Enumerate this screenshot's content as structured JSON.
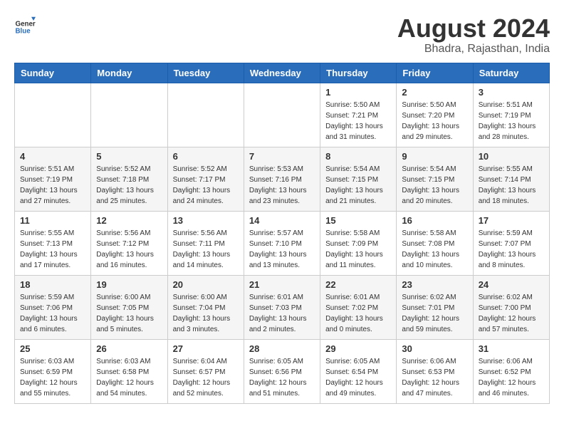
{
  "logo": {
    "general": "General",
    "blue": "Blue"
  },
  "title": {
    "month_year": "August 2024",
    "location": "Bhadra, Rajasthan, India"
  },
  "headers": [
    "Sunday",
    "Monday",
    "Tuesday",
    "Wednesday",
    "Thursday",
    "Friday",
    "Saturday"
  ],
  "weeks": [
    [
      {
        "day": "",
        "sunrise": "",
        "sunset": "",
        "daylight": ""
      },
      {
        "day": "",
        "sunrise": "",
        "sunset": "",
        "daylight": ""
      },
      {
        "day": "",
        "sunrise": "",
        "sunset": "",
        "daylight": ""
      },
      {
        "day": "",
        "sunrise": "",
        "sunset": "",
        "daylight": ""
      },
      {
        "day": "1",
        "sunrise": "Sunrise: 5:50 AM",
        "sunset": "Sunset: 7:21 PM",
        "daylight": "Daylight: 13 hours and 31 minutes."
      },
      {
        "day": "2",
        "sunrise": "Sunrise: 5:50 AM",
        "sunset": "Sunset: 7:20 PM",
        "daylight": "Daylight: 13 hours and 29 minutes."
      },
      {
        "day": "3",
        "sunrise": "Sunrise: 5:51 AM",
        "sunset": "Sunset: 7:19 PM",
        "daylight": "Daylight: 13 hours and 28 minutes."
      }
    ],
    [
      {
        "day": "4",
        "sunrise": "Sunrise: 5:51 AM",
        "sunset": "Sunset: 7:19 PM",
        "daylight": "Daylight: 13 hours and 27 minutes."
      },
      {
        "day": "5",
        "sunrise": "Sunrise: 5:52 AM",
        "sunset": "Sunset: 7:18 PM",
        "daylight": "Daylight: 13 hours and 25 minutes."
      },
      {
        "day": "6",
        "sunrise": "Sunrise: 5:52 AM",
        "sunset": "Sunset: 7:17 PM",
        "daylight": "Daylight: 13 hours and 24 minutes."
      },
      {
        "day": "7",
        "sunrise": "Sunrise: 5:53 AM",
        "sunset": "Sunset: 7:16 PM",
        "daylight": "Daylight: 13 hours and 23 minutes."
      },
      {
        "day": "8",
        "sunrise": "Sunrise: 5:54 AM",
        "sunset": "Sunset: 7:15 PM",
        "daylight": "Daylight: 13 hours and 21 minutes."
      },
      {
        "day": "9",
        "sunrise": "Sunrise: 5:54 AM",
        "sunset": "Sunset: 7:15 PM",
        "daylight": "Daylight: 13 hours and 20 minutes."
      },
      {
        "day": "10",
        "sunrise": "Sunrise: 5:55 AM",
        "sunset": "Sunset: 7:14 PM",
        "daylight": "Daylight: 13 hours and 18 minutes."
      }
    ],
    [
      {
        "day": "11",
        "sunrise": "Sunrise: 5:55 AM",
        "sunset": "Sunset: 7:13 PM",
        "daylight": "Daylight: 13 hours and 17 minutes."
      },
      {
        "day": "12",
        "sunrise": "Sunrise: 5:56 AM",
        "sunset": "Sunset: 7:12 PM",
        "daylight": "Daylight: 13 hours and 16 minutes."
      },
      {
        "day": "13",
        "sunrise": "Sunrise: 5:56 AM",
        "sunset": "Sunset: 7:11 PM",
        "daylight": "Daylight: 13 hours and 14 minutes."
      },
      {
        "day": "14",
        "sunrise": "Sunrise: 5:57 AM",
        "sunset": "Sunset: 7:10 PM",
        "daylight": "Daylight: 13 hours and 13 minutes."
      },
      {
        "day": "15",
        "sunrise": "Sunrise: 5:58 AM",
        "sunset": "Sunset: 7:09 PM",
        "daylight": "Daylight: 13 hours and 11 minutes."
      },
      {
        "day": "16",
        "sunrise": "Sunrise: 5:58 AM",
        "sunset": "Sunset: 7:08 PM",
        "daylight": "Daylight: 13 hours and 10 minutes."
      },
      {
        "day": "17",
        "sunrise": "Sunrise: 5:59 AM",
        "sunset": "Sunset: 7:07 PM",
        "daylight": "Daylight: 13 hours and 8 minutes."
      }
    ],
    [
      {
        "day": "18",
        "sunrise": "Sunrise: 5:59 AM",
        "sunset": "Sunset: 7:06 PM",
        "daylight": "Daylight: 13 hours and 6 minutes."
      },
      {
        "day": "19",
        "sunrise": "Sunrise: 6:00 AM",
        "sunset": "Sunset: 7:05 PM",
        "daylight": "Daylight: 13 hours and 5 minutes."
      },
      {
        "day": "20",
        "sunrise": "Sunrise: 6:00 AM",
        "sunset": "Sunset: 7:04 PM",
        "daylight": "Daylight: 13 hours and 3 minutes."
      },
      {
        "day": "21",
        "sunrise": "Sunrise: 6:01 AM",
        "sunset": "Sunset: 7:03 PM",
        "daylight": "Daylight: 13 hours and 2 minutes."
      },
      {
        "day": "22",
        "sunrise": "Sunrise: 6:01 AM",
        "sunset": "Sunset: 7:02 PM",
        "daylight": "Daylight: 13 hours and 0 minutes."
      },
      {
        "day": "23",
        "sunrise": "Sunrise: 6:02 AM",
        "sunset": "Sunset: 7:01 PM",
        "daylight": "Daylight: 12 hours and 59 minutes."
      },
      {
        "day": "24",
        "sunrise": "Sunrise: 6:02 AM",
        "sunset": "Sunset: 7:00 PM",
        "daylight": "Daylight: 12 hours and 57 minutes."
      }
    ],
    [
      {
        "day": "25",
        "sunrise": "Sunrise: 6:03 AM",
        "sunset": "Sunset: 6:59 PM",
        "daylight": "Daylight: 12 hours and 55 minutes."
      },
      {
        "day": "26",
        "sunrise": "Sunrise: 6:03 AM",
        "sunset": "Sunset: 6:58 PM",
        "daylight": "Daylight: 12 hours and 54 minutes."
      },
      {
        "day": "27",
        "sunrise": "Sunrise: 6:04 AM",
        "sunset": "Sunset: 6:57 PM",
        "daylight": "Daylight: 12 hours and 52 minutes."
      },
      {
        "day": "28",
        "sunrise": "Sunrise: 6:05 AM",
        "sunset": "Sunset: 6:56 PM",
        "daylight": "Daylight: 12 hours and 51 minutes."
      },
      {
        "day": "29",
        "sunrise": "Sunrise: 6:05 AM",
        "sunset": "Sunset: 6:54 PM",
        "daylight": "Daylight: 12 hours and 49 minutes."
      },
      {
        "day": "30",
        "sunrise": "Sunrise: 6:06 AM",
        "sunset": "Sunset: 6:53 PM",
        "daylight": "Daylight: 12 hours and 47 minutes."
      },
      {
        "day": "31",
        "sunrise": "Sunrise: 6:06 AM",
        "sunset": "Sunset: 6:52 PM",
        "daylight": "Daylight: 12 hours and 46 minutes."
      }
    ]
  ]
}
